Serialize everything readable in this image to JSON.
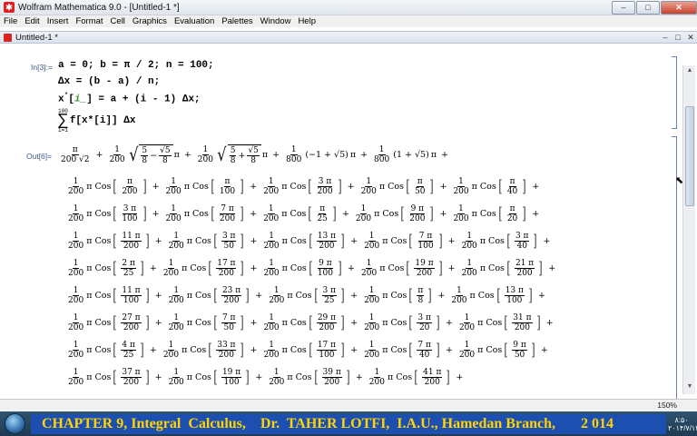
{
  "window": {
    "title": "Wolfram Mathematica 9.0 - [Untitled-1 *]",
    "minimize": "–",
    "maximize": "□",
    "close": "✕"
  },
  "menu": [
    "File",
    "Edit",
    "Insert",
    "Format",
    "Cell",
    "Graphics",
    "Evaluation",
    "Palettes",
    "Window",
    "Help"
  ],
  "document": {
    "title": "Untitled-1 *"
  },
  "input": {
    "label": "In[3]:=",
    "line1": "a = 0; b = π / 2; n = 100;",
    "line2": "Δx = (b - a) / n;",
    "line3_a": "x",
    "line3_b": "*",
    "line3_c": "[",
    "line3_d": "i_",
    "line3_e": "] = a + (i - 1) Δx;",
    "line4_sum": "∑",
    "line4_top": "100",
    "line4_bottom": "i=1",
    "line4_body": "f[x*[i]] Δx"
  },
  "output": {
    "label": "Out[6]=",
    "first_terms": [
      {
        "num": "π",
        "den": "200 √2"
      },
      {
        "num": "1",
        "den": "200"
      },
      {
        "inner_a_num": "5",
        "inner_a_den": "8",
        "op": "−",
        "inner_b_num": "√5",
        "inner_b_den": "8"
      },
      {
        "num": "1",
        "den": "200"
      },
      {
        "inner_a_num": "5",
        "inner_a_den": "8",
        "op": "+",
        "inner_b_num": "√5",
        "inner_b_den": "8"
      },
      {
        "num": "1",
        "den": "800"
      },
      {
        "paren": "(−1 + √5)"
      },
      {
        "num": "1",
        "den": "800"
      },
      {
        "paren": "(1 + √5)"
      }
    ],
    "pi": "π",
    "plus": "+",
    "coef_num": "1",
    "coef_den": "200",
    "cos": "π Cos",
    "rows": [
      [
        [
          "π",
          "200"
        ],
        [
          "π",
          "100"
        ],
        [
          "3 π",
          "200"
        ],
        [
          "π",
          "50"
        ],
        [
          "π",
          "40"
        ]
      ],
      [
        [
          "3 π",
          "100"
        ],
        [
          "7 π",
          "200"
        ],
        [
          "π",
          "25"
        ],
        [
          "9 π",
          "200"
        ],
        [
          "π",
          "20"
        ]
      ],
      [
        [
          "11 π",
          "200"
        ],
        [
          "3 π",
          "50"
        ],
        [
          "13 π",
          "200"
        ],
        [
          "7 π",
          "100"
        ],
        [
          "3 π",
          "40"
        ]
      ],
      [
        [
          "2 π",
          "25"
        ],
        [
          "17 π",
          "200"
        ],
        [
          "9 π",
          "100"
        ],
        [
          "19 π",
          "200"
        ],
        [
          "21 π",
          "200"
        ]
      ],
      [
        [
          "11 π",
          "100"
        ],
        [
          "23 π",
          "200"
        ],
        [
          "3 π",
          "25"
        ],
        [
          "π",
          "8"
        ],
        [
          "13 π",
          "100"
        ]
      ],
      [
        [
          "27 π",
          "200"
        ],
        [
          "7 π",
          "50"
        ],
        [
          "29 π",
          "200"
        ],
        [
          "3 π",
          "20"
        ],
        [
          "31 π",
          "200"
        ]
      ],
      [
        [
          "4 π",
          "25"
        ],
        [
          "33 π",
          "200"
        ],
        [
          "17 π",
          "100"
        ],
        [
          "7 π",
          "40"
        ],
        [
          "9 π",
          "50"
        ]
      ],
      [
        [
          "37 π",
          "200"
        ],
        [
          "19 π",
          "100"
        ],
        [
          "39 π",
          "200"
        ],
        [
          "41 π",
          "200"
        ]
      ]
    ]
  },
  "status": {
    "zoom": "150%"
  },
  "banner": "CHAPTER 9, Integral  Calculus,    Dr.  TAHER LOTFI,  I.A.U., Hamedan Branch,       2 014",
  "clock": {
    "time": "۸:۵۰",
    "date": "۲۰۱۴/۷/۱۲"
  }
}
